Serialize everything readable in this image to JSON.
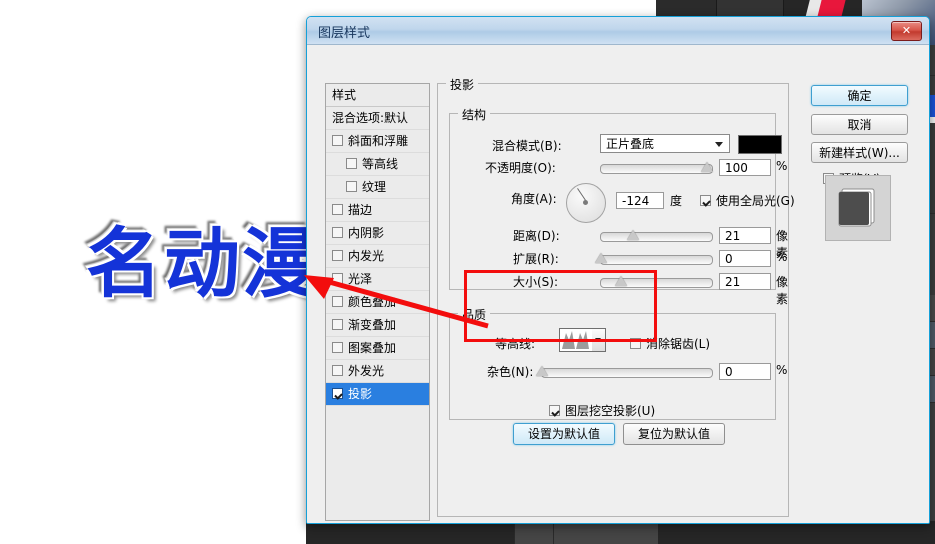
{
  "background": {
    "app": "photoshop",
    "artwork_text": "名动漫",
    "artwork_color": "#1433d8",
    "car_icon": "car-icon"
  },
  "dialog": {
    "title": "图层样式",
    "close_label": "✕",
    "accent_border": "#15a0d8"
  },
  "sidebar": {
    "header": "样式",
    "items": [
      {
        "label": "混合选项:默认",
        "checkbox": false,
        "has_checkbox": false,
        "sub": false,
        "selected": false
      },
      {
        "label": "斜面和浮雕",
        "checkbox": false,
        "has_checkbox": true,
        "sub": false,
        "selected": false
      },
      {
        "label": "等高线",
        "checkbox": false,
        "has_checkbox": true,
        "sub": true,
        "selected": false
      },
      {
        "label": "纹理",
        "checkbox": false,
        "has_checkbox": true,
        "sub": true,
        "selected": false
      },
      {
        "label": "描边",
        "checkbox": false,
        "has_checkbox": true,
        "sub": false,
        "selected": false
      },
      {
        "label": "内阴影",
        "checkbox": false,
        "has_checkbox": true,
        "sub": false,
        "selected": false
      },
      {
        "label": "内发光",
        "checkbox": false,
        "has_checkbox": true,
        "sub": false,
        "selected": false
      },
      {
        "label": "光泽",
        "checkbox": false,
        "has_checkbox": true,
        "sub": false,
        "selected": false
      },
      {
        "label": "颜色叠加",
        "checkbox": false,
        "has_checkbox": true,
        "sub": false,
        "selected": false
      },
      {
        "label": "渐变叠加",
        "checkbox": false,
        "has_checkbox": true,
        "sub": false,
        "selected": false
      },
      {
        "label": "图案叠加",
        "checkbox": false,
        "has_checkbox": true,
        "sub": false,
        "selected": false
      },
      {
        "label": "外发光",
        "checkbox": false,
        "has_checkbox": true,
        "sub": false,
        "selected": false
      },
      {
        "label": "投影",
        "checkbox": true,
        "has_checkbox": true,
        "sub": false,
        "selected": true
      }
    ]
  },
  "main": {
    "panel_title": "投影",
    "structure": {
      "title": "结构",
      "blend_mode_label": "混合模式(B):",
      "blend_mode_value": "正片叠底",
      "shadow_color": "#000000",
      "opacity_label": "不透明度(O):",
      "opacity_value": "100",
      "opacity_unit": "%",
      "angle_label": "角度(A):",
      "angle_value": "-124",
      "angle_unit": "度",
      "global_light_label": "使用全局光(G)",
      "global_light_checked": true,
      "distance_label": "距离(D):",
      "distance_value": "21",
      "distance_unit": "像素",
      "spread_label": "扩展(R):",
      "spread_value": "0",
      "spread_unit": "%",
      "size_label": "大小(S):",
      "size_value": "21",
      "size_unit": "像素"
    },
    "quality": {
      "title": "品质",
      "contour_label": "等高线:",
      "antialias_label": "消除锯齿(L)",
      "antialias_checked": false,
      "noise_label": "杂色(N):",
      "noise_value": "0",
      "noise_unit": "%"
    },
    "knockout_label": "图层挖空投影(U)",
    "knockout_checked": true,
    "set_default_button": "设置为默认值",
    "reset_default_button": "复位为默认值"
  },
  "right": {
    "ok_button": "确定",
    "cancel_button": "取消",
    "new_style_button": "新建样式(W)...",
    "preview_label": "预览(V)",
    "preview_checked": true
  },
  "annotation": {
    "highlight_color": "#f30d0d",
    "arrow_color": "#f30d0d"
  }
}
